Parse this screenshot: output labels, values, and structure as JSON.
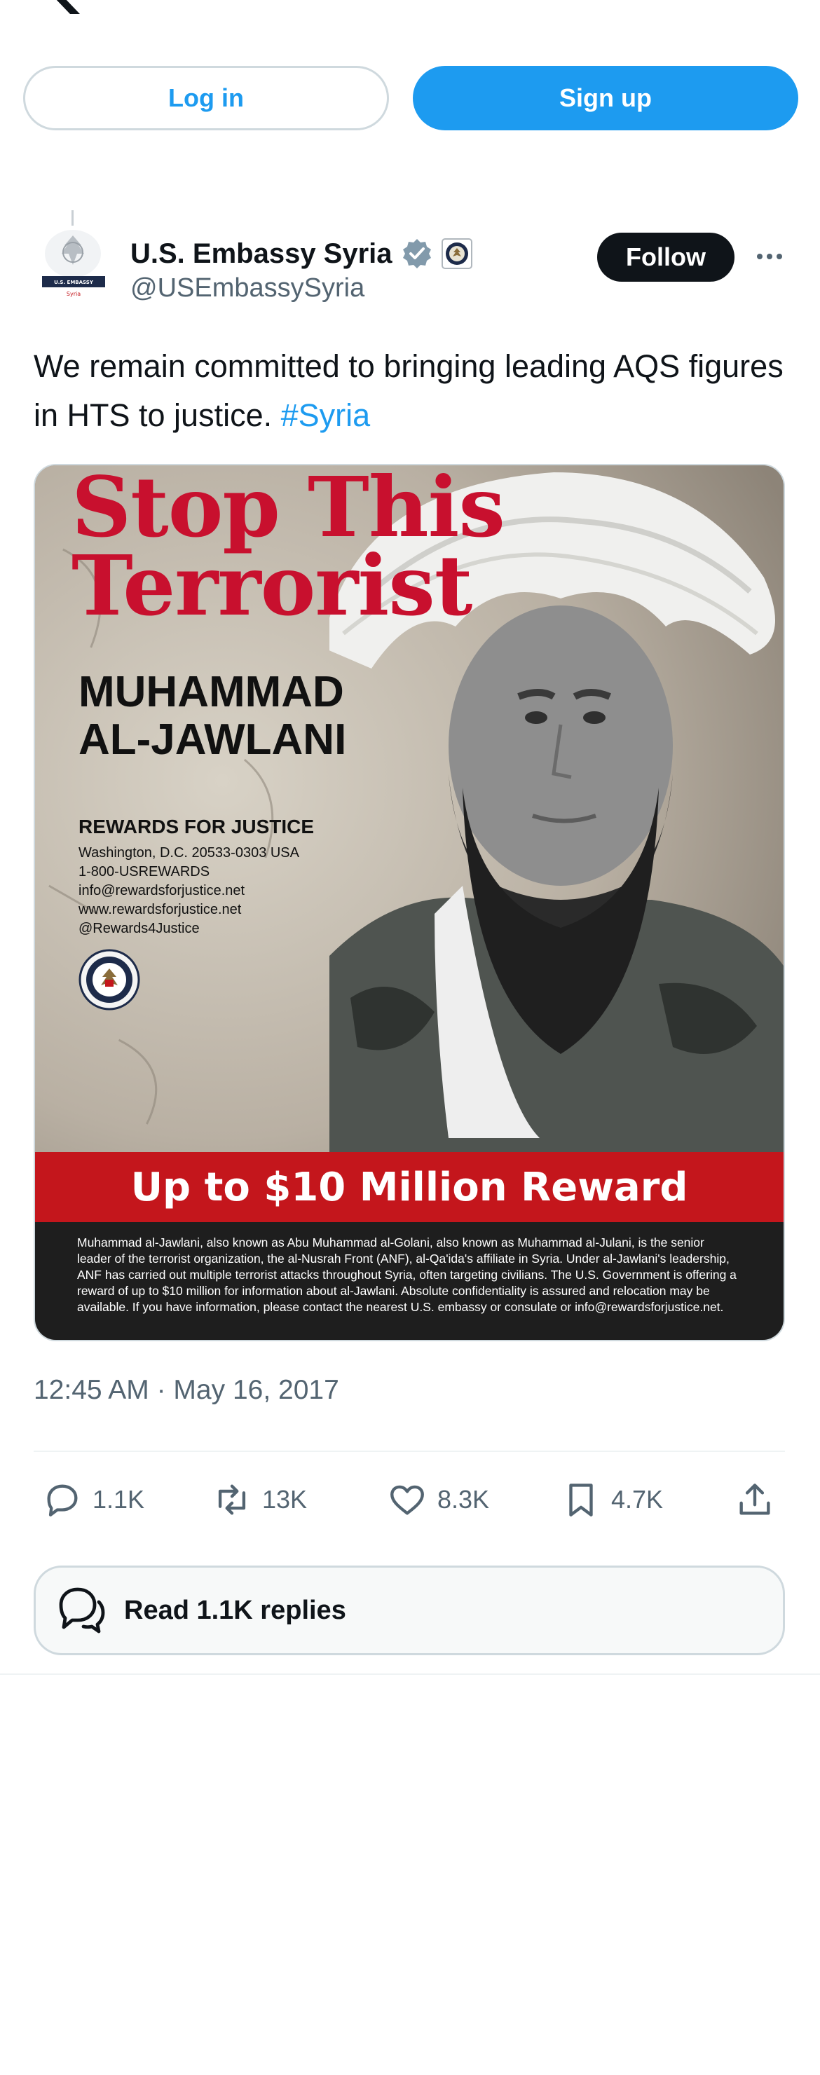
{
  "auth": {
    "login_label": "Log in",
    "signup_label": "Sign up"
  },
  "author": {
    "name": "U.S. Embassy Syria",
    "handle": "@USEmbassySyria",
    "avatar_caption_top": "U.S. EMBASSY",
    "avatar_caption_bottom": "Syria"
  },
  "follow_label": "Follow",
  "tweet": {
    "text": "We remain committed to bringing leading AQS figures in HTS to justice. ",
    "hashtag": "#Syria"
  },
  "poster": {
    "title_line1": "Stop This",
    "title_line2": "Terrorist",
    "name_line1": "MUHAMMAD",
    "name_line2": "AL-JAWLANI",
    "org": "REWARDS FOR JUSTICE",
    "contact": [
      "Washington, D.C. 20533-0303 USA",
      "1-800-USREWARDS",
      "info@rewardsforjustice.net",
      "www.rewardsforjustice.net",
      "@Rewards4Justice"
    ],
    "reward": "Up to $10 Million Reward",
    "fine_print": "Muhammad al-Jawlani, also known as Abu Muhammad al-Golani, also known as Muhammad al-Julani, is the senior leader of the terrorist organization, the al-Nusrah Front (ANF), al-Qa'ida's affiliate in Syria. Under al-Jawlani's leadership, ANF has carried out multiple terrorist attacks throughout Syria, often targeting civilians. The U.S. Government is offering a reward of up to $10 million for information about al-Jawlani. Absolute confidentiality is assured and relocation may be available. If you have information, please contact the nearest U.S. embassy or consulate or info@rewardsforjustice.net."
  },
  "timestamp": "12:45 AM · May 16, 2017",
  "metrics": {
    "replies": "1.1K",
    "reposts": "13K",
    "likes": "8.3K",
    "bookmarks": "4.7K"
  },
  "read_replies_label": "Read 1.1K replies",
  "colors": {
    "accent": "#1d9bf0",
    "text": "#0f1419",
    "muted": "#536471",
    "poster_red": "#c4161c"
  },
  "icons": [
    "x-logo-icon",
    "verified-badge-icon",
    "government-seal-icon",
    "more-icon",
    "reply-icon",
    "repost-icon",
    "like-icon",
    "bookmark-icon",
    "share-icon",
    "speech-bubbles-icon"
  ]
}
